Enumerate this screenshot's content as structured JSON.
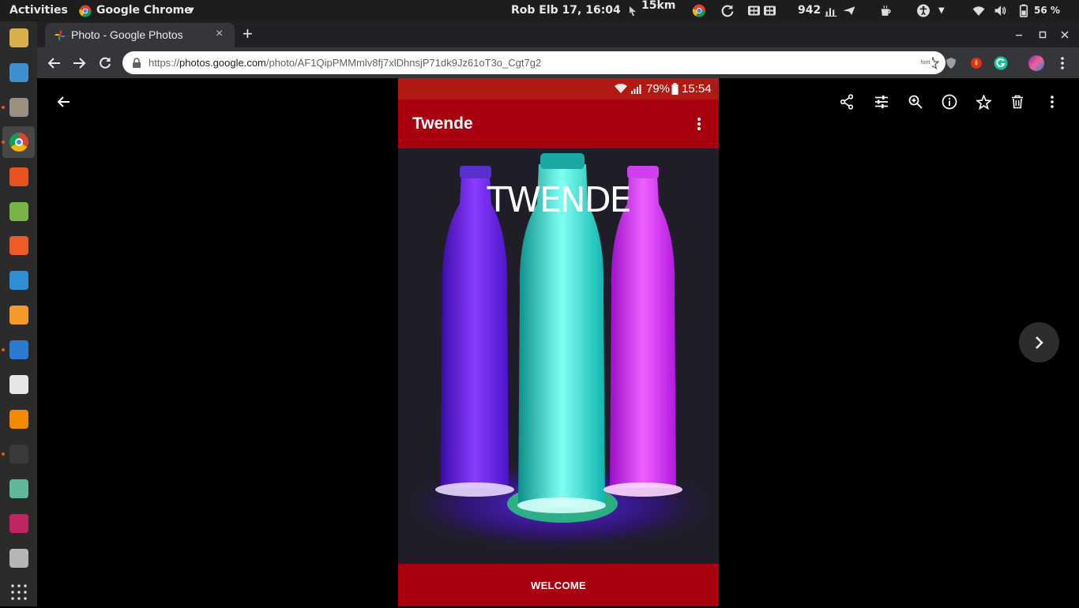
{
  "topbar": {
    "activities": "Activities",
    "app_name": "Google Chrome",
    "clock": "Rob Elb 17, 16:04",
    "speed": "15km",
    "counter": "942",
    "battery": "56 %"
  },
  "dock": {
    "items": [
      {
        "name": "rhythmbox",
        "color": "#d8b04a"
      },
      {
        "name": "libreoffice-writer",
        "color": "#3e8ed0"
      },
      {
        "name": "files",
        "color": "#9b8f7f"
      },
      {
        "name": "chrome",
        "color": "#4285f4"
      },
      {
        "name": "software-center",
        "color": "#e95420"
      },
      {
        "name": "android-studio",
        "color": "#76b447"
      },
      {
        "name": "postman",
        "color": "#ef5b25"
      },
      {
        "name": "help",
        "color": "#2e8fd6"
      },
      {
        "name": "sublime-text",
        "color": "#f29b2a"
      },
      {
        "name": "vscode",
        "color": "#2b7bd2"
      },
      {
        "name": "amazon",
        "color": "#e6e6e6"
      },
      {
        "name": "vlc",
        "color": "#f08a00"
      },
      {
        "name": "terminal",
        "color": "#3a3a3a"
      },
      {
        "name": "atom",
        "color": "#5fb89a"
      },
      {
        "name": "intellij",
        "color": "#c12663"
      },
      {
        "name": "settings",
        "color": "#b5b5b5"
      },
      {
        "name": "show-apps",
        "color": "#2b2b2b"
      }
    ]
  },
  "chrome": {
    "tab_title": "Photo - Google Photos",
    "new_tab_symbol": "+",
    "url_prefix": "https://",
    "url_domain": "photos.google.com",
    "url_path": "/photo/AF1QipPMMmlv8fj7xlDhnsjP71dk9Jz61oT3o_Cgt7g2",
    "ext_font_label": "font"
  },
  "phone": {
    "battery": "79%",
    "time": "15:54",
    "app_title": "Twende",
    "logo_text": "TWENDE",
    "welcome_label": "WELCOME"
  },
  "colors": {
    "app_red": "#a8000f",
    "status_red": "#b01a12",
    "bottle_purple": "#7a2cff",
    "bottle_cyan": "#3df2e6",
    "bottle_magenta": "#e030ff"
  }
}
